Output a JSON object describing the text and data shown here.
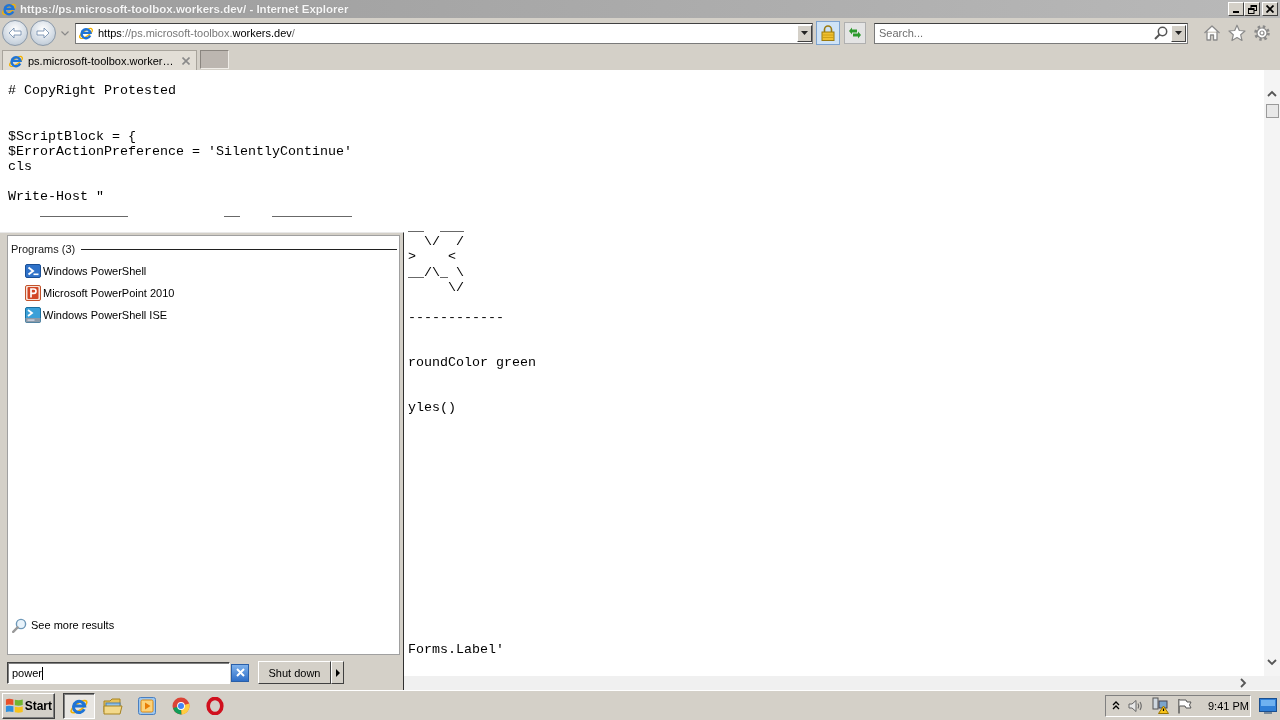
{
  "window": {
    "title": "https://ps.microsoft-toolbox.workers.dev/ - Internet Explorer"
  },
  "address_bar": {
    "url_parts": [
      {
        "text": "https",
        "highlighted": true
      },
      {
        "text": "://ps.microsoft-toolbox.",
        "highlighted": false
      },
      {
        "text": "workers.dev",
        "highlighted": true
      },
      {
        "text": "/",
        "highlighted": false
      }
    ]
  },
  "search_box": {
    "placeholder": "Search..."
  },
  "tabs": [
    {
      "label": "ps.microsoft-toolbox.worker…",
      "selected": true
    }
  ],
  "page": {
    "lines": [
      {
        "kind": "code",
        "text": "# CopyRight Protested"
      },
      {
        "kind": "blank"
      },
      {
        "kind": "blank"
      },
      {
        "kind": "code",
        "text": "$ScriptBlock = {"
      },
      {
        "kind": "code",
        "text": "$ErrorActionPreference = 'SilentlyContinue'"
      },
      {
        "kind": "code",
        "text": "cls"
      },
      {
        "kind": "blank"
      },
      {
        "kind": "code",
        "text": "Write-Host \""
      },
      {
        "kind": "code",
        "text": "    ___________            __    __________"
      },
      {
        "kind": "tail",
        "text": "__  ___"
      },
      {
        "kind": "tail",
        "text": "  \\/  /"
      },
      {
        "kind": "tail",
        "text": ">    <"
      },
      {
        "kind": "tail",
        "text": "__/\\_ \\"
      },
      {
        "kind": "tail",
        "text": "     \\/"
      },
      {
        "kind": "blank"
      },
      {
        "kind": "tail",
        "text": "------------"
      },
      {
        "kind": "blank"
      },
      {
        "kind": "blank"
      },
      {
        "kind": "tail",
        "text": "roundColor green"
      },
      {
        "kind": "blank"
      },
      {
        "kind": "blank"
      },
      {
        "kind": "tail",
        "text": "yles()"
      },
      {
        "kind": "blank"
      },
      {
        "kind": "blank"
      },
      {
        "kind": "blank"
      },
      {
        "kind": "blank"
      },
      {
        "kind": "blank"
      },
      {
        "kind": "blank"
      },
      {
        "kind": "blank"
      },
      {
        "kind": "blank"
      },
      {
        "kind": "blank"
      },
      {
        "kind": "blank"
      },
      {
        "kind": "blank"
      },
      {
        "kind": "blank"
      },
      {
        "kind": "blank"
      },
      {
        "kind": "blank"
      },
      {
        "kind": "blank"
      },
      {
        "kind": "tail",
        "text": "Forms.Label'"
      }
    ]
  },
  "start_menu": {
    "group_label": "Programs (3)",
    "programs": [
      {
        "label": "Windows PowerShell",
        "kind": "powershell"
      },
      {
        "label": "Microsoft PowerPoint 2010",
        "kind": "powerpoint"
      },
      {
        "label": "Windows PowerShell ISE",
        "kind": "powershell-ise"
      }
    ],
    "more_results": "See more results",
    "search_value": "power",
    "shut_down": "Shut down"
  },
  "taskbar": {
    "start": "Start",
    "apps": [
      {
        "kind": "browser",
        "selected": true
      },
      {
        "kind": "folder",
        "selected": false
      },
      {
        "kind": "media",
        "selected": false
      },
      {
        "kind": "chrome",
        "selected": false
      },
      {
        "kind": "opera",
        "selected": false
      }
    ],
    "clock": "9:41 PM"
  }
}
